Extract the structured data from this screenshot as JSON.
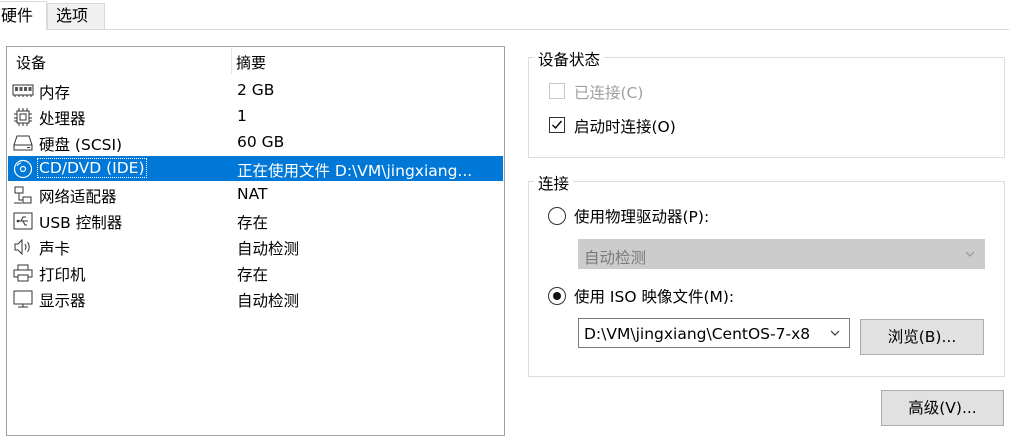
{
  "tabs": [
    {
      "label": "硬件",
      "active": true
    },
    {
      "label": "选项",
      "active": false
    }
  ],
  "device_list": {
    "columns": [
      "设备",
      "摘要"
    ],
    "rows": [
      {
        "icon": "memory-icon",
        "name": "内存",
        "summary": "2 GB"
      },
      {
        "icon": "processor-icon",
        "name": "处理器",
        "summary": "1"
      },
      {
        "icon": "hard-disk-icon",
        "name": "硬盘 (SCSI)",
        "summary": "60 GB"
      },
      {
        "icon": "cd-dvd-icon",
        "name": "CD/DVD (IDE)",
        "summary": "正在使用文件 D:\\VM\\jingxiang...",
        "selected": true
      },
      {
        "icon": "network-adapter-icon",
        "name": "网络适配器",
        "summary": "NAT"
      },
      {
        "icon": "usb-icon",
        "name": "USB 控制器",
        "summary": "存在"
      },
      {
        "icon": "sound-card-icon",
        "name": "声卡",
        "summary": "自动检测"
      },
      {
        "icon": "printer-icon",
        "name": "打印机",
        "summary": "存在"
      },
      {
        "icon": "display-icon",
        "name": "显示器",
        "summary": "自动检测"
      }
    ]
  },
  "device_status": {
    "title": "设备状态",
    "connected": {
      "label": "已连接(C)",
      "checked": false,
      "enabled": false
    },
    "connect_at_power_on": {
      "label": "启动时连接(O)",
      "checked": true,
      "enabled": true
    }
  },
  "connection": {
    "title": "连接",
    "physical_drive": {
      "label": "使用物理驱动器(P):",
      "selected": false,
      "dropdown_value": "自动检测"
    },
    "iso_image": {
      "label": "使用 ISO 映像文件(M):",
      "selected": true,
      "path_value": "D:\\VM\\jingxiang\\CentOS-7-x8"
    },
    "browse_label": "浏览(B)..."
  },
  "advanced_label": "高级(V)...",
  "colors": {
    "selection": "#0078d7",
    "disabled_dropdown": "#cccccc",
    "button": "#e1e1e1"
  }
}
